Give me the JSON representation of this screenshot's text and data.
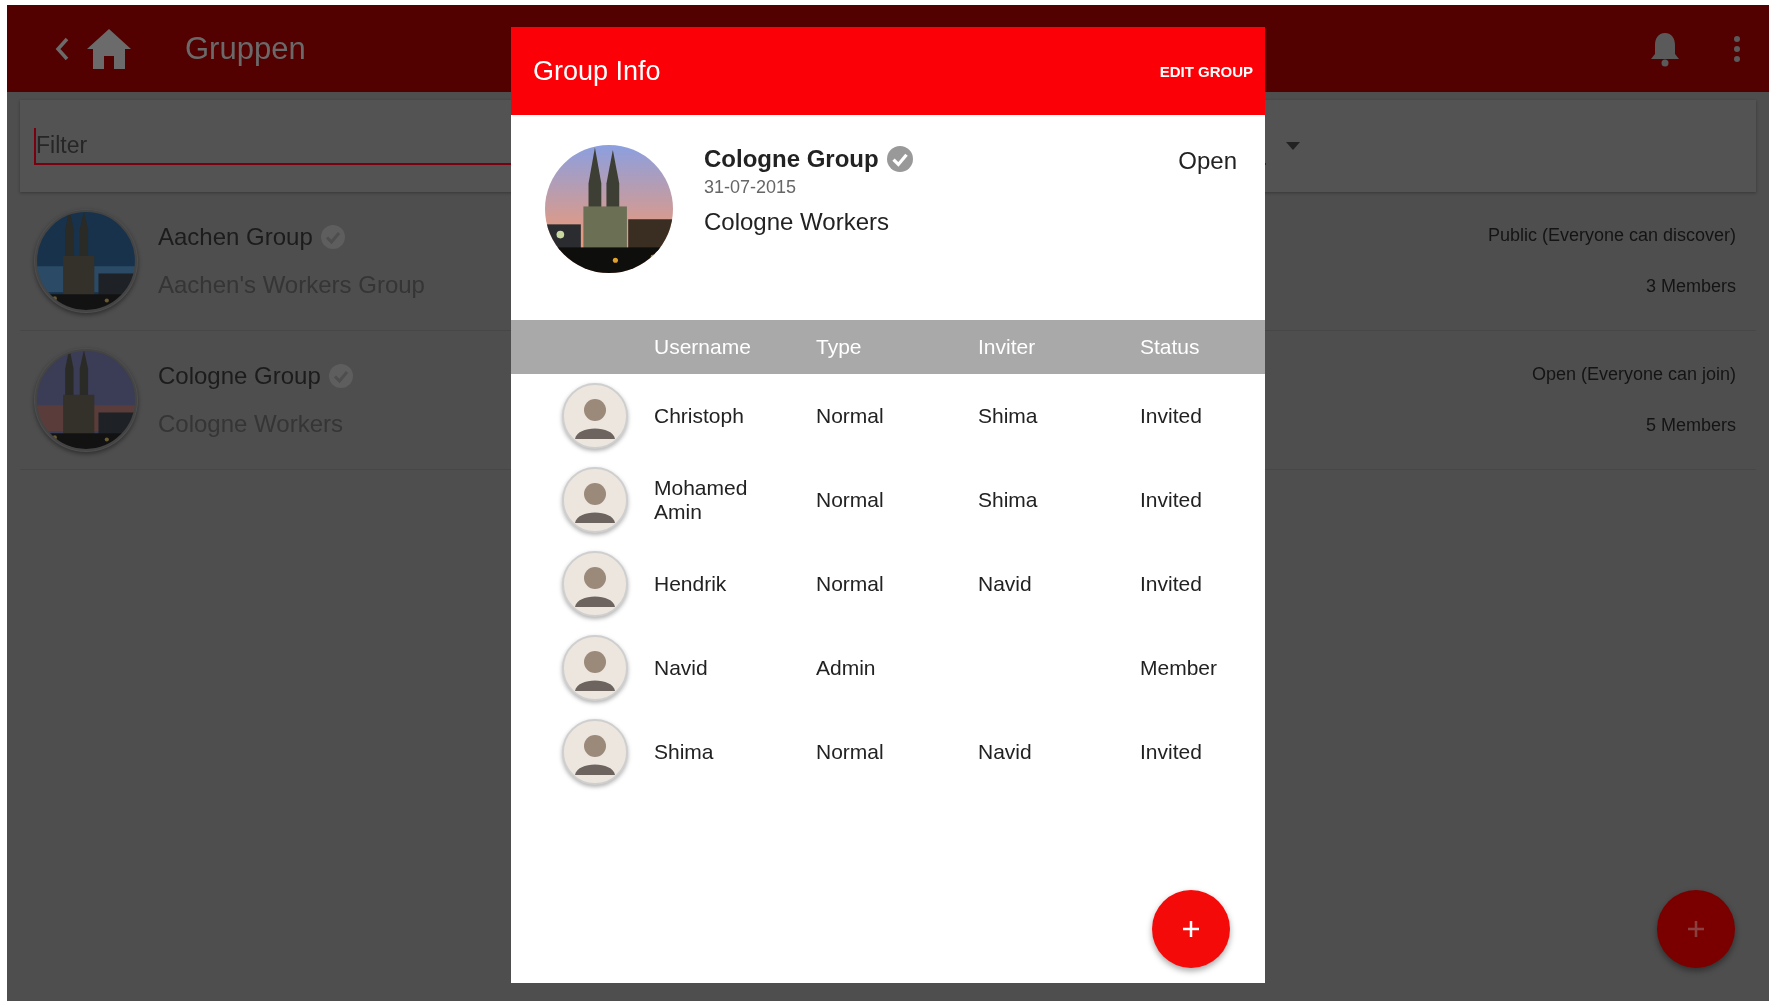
{
  "app_bar": {
    "title": "Gruppen"
  },
  "filter": {
    "placeholder": "Filter"
  },
  "groups": [
    {
      "name": "Aachen Group",
      "verified": true,
      "description": "Aachen's Workers Group",
      "visibility": "Public (Everyone can discover)",
      "members": "3 Members"
    },
    {
      "name": "Cologne Group",
      "verified": true,
      "description": "Cologne Workers",
      "visibility": "Open (Everyone can join)",
      "members": "5 Members"
    }
  ],
  "dialog": {
    "title": "Group Info",
    "action": "EDIT GROUP",
    "group": {
      "name": "Cologne Group",
      "verified": true,
      "date": "31-07-2015",
      "description": "Cologne Workers",
      "status": "Open"
    },
    "columns": [
      "Username",
      "Type",
      "Inviter",
      "Status"
    ],
    "members": [
      {
        "username": "Christoph",
        "type": "Normal",
        "inviter": "Shima",
        "status": "Invited"
      },
      {
        "username": "Mohamed Amin",
        "type": "Normal",
        "inviter": "Shima",
        "status": "Invited"
      },
      {
        "username": "Hendrik",
        "type": "Normal",
        "inviter": "Navid",
        "status": "Invited"
      },
      {
        "username": "Navid",
        "type": "Admin",
        "status": "Member"
      },
      {
        "username": "Shima",
        "type": "Normal",
        "inviter": "Navid",
        "status": "Invited"
      }
    ]
  }
}
